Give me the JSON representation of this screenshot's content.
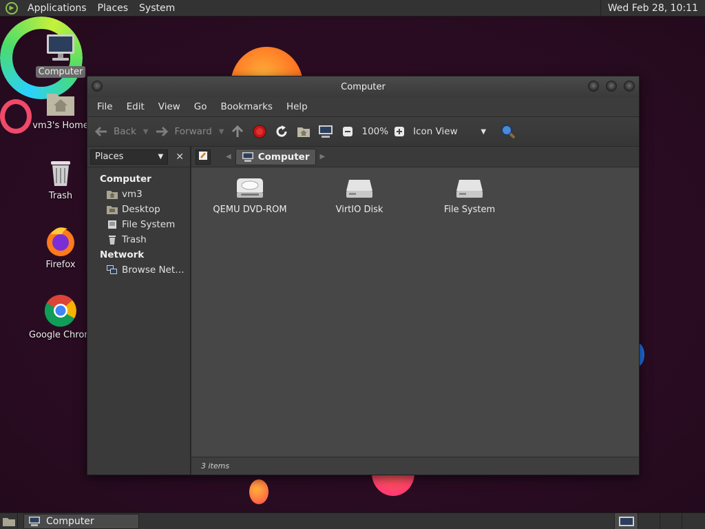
{
  "top_panel": {
    "menus": [
      "Applications",
      "Places",
      "System"
    ],
    "clock": "Wed Feb 28, 10:11"
  },
  "desktop_icons": [
    {
      "label": "Computer",
      "icon": "computer-icon",
      "selected": true
    },
    {
      "label": "vm3's Home",
      "icon": "home-folder-icon"
    },
    {
      "label": "Trash",
      "icon": "trash-icon"
    },
    {
      "label": "Firefox",
      "icon": "firefox-icon"
    },
    {
      "label": "Google Chrom",
      "icon": "chrome-icon"
    }
  ],
  "window": {
    "title": "Computer",
    "menus": [
      "File",
      "Edit",
      "View",
      "Go",
      "Bookmarks",
      "Help"
    ],
    "toolbar": {
      "back": "Back",
      "forward": "Forward",
      "zoom": "100%",
      "view_mode": "Icon View"
    },
    "sidebar": {
      "selector": "Places",
      "sections": [
        {
          "heading": "Computer",
          "items": [
            {
              "label": "vm3",
              "icon": "home-icon"
            },
            {
              "label": "Desktop",
              "icon": "desktop-icon"
            },
            {
              "label": "File System",
              "icon": "drive-icon"
            },
            {
              "label": "Trash",
              "icon": "trash-icon"
            }
          ]
        },
        {
          "heading": "Network",
          "items": [
            {
              "label": "Browse Net…",
              "icon": "network-icon"
            }
          ]
        }
      ]
    },
    "pathbar": {
      "crumb": "Computer"
    },
    "items": [
      {
        "label": "QEMU DVD-ROM",
        "icon": "optical-drive-icon"
      },
      {
        "label": "VirtIO Disk",
        "icon": "hard-disk-icon"
      },
      {
        "label": "File System",
        "icon": "hard-disk-icon"
      }
    ],
    "status": "3 items"
  },
  "taskbar": {
    "task": "Computer"
  }
}
